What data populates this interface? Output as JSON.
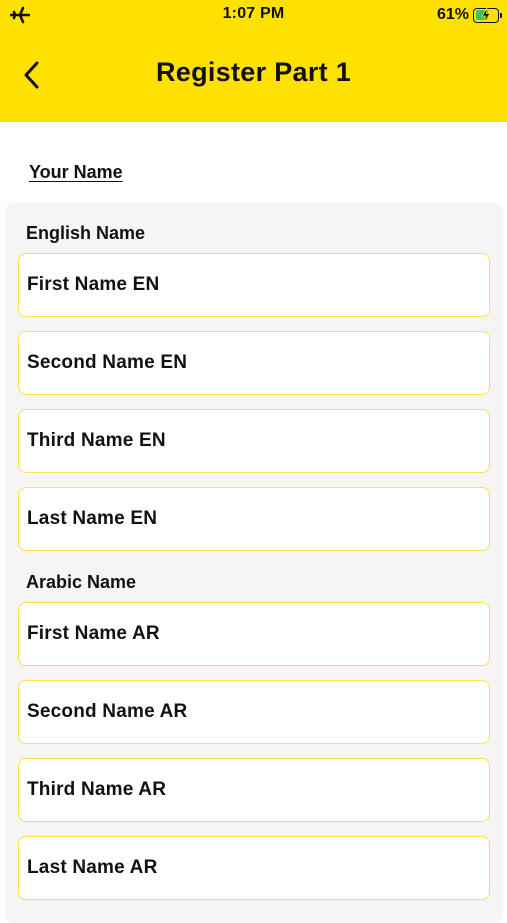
{
  "status_bar": {
    "time": "1:07 PM",
    "battery_percent": "61%",
    "battery_level": 0.61,
    "left_icon": "airplane-icon"
  },
  "header": {
    "title": "Register Part 1",
    "back_icon": "chevron-left-icon",
    "background_color": "#FFE100"
  },
  "section": {
    "title": "Your Name"
  },
  "english": {
    "label": "English Name",
    "fields": {
      "first": "First Name EN",
      "second": "Second Name EN",
      "third": "Third Name EN",
      "last": "Last Name EN"
    }
  },
  "arabic": {
    "label": "Arabic Name",
    "fields": {
      "first": "First Name AR",
      "second": "Second Name AR",
      "third": "Third Name AR",
      "last": "Last Name AR"
    }
  },
  "colors": {
    "accent": "#FFE100",
    "field_border": "#FFE14D",
    "card_background": "#F5F5F5"
  }
}
